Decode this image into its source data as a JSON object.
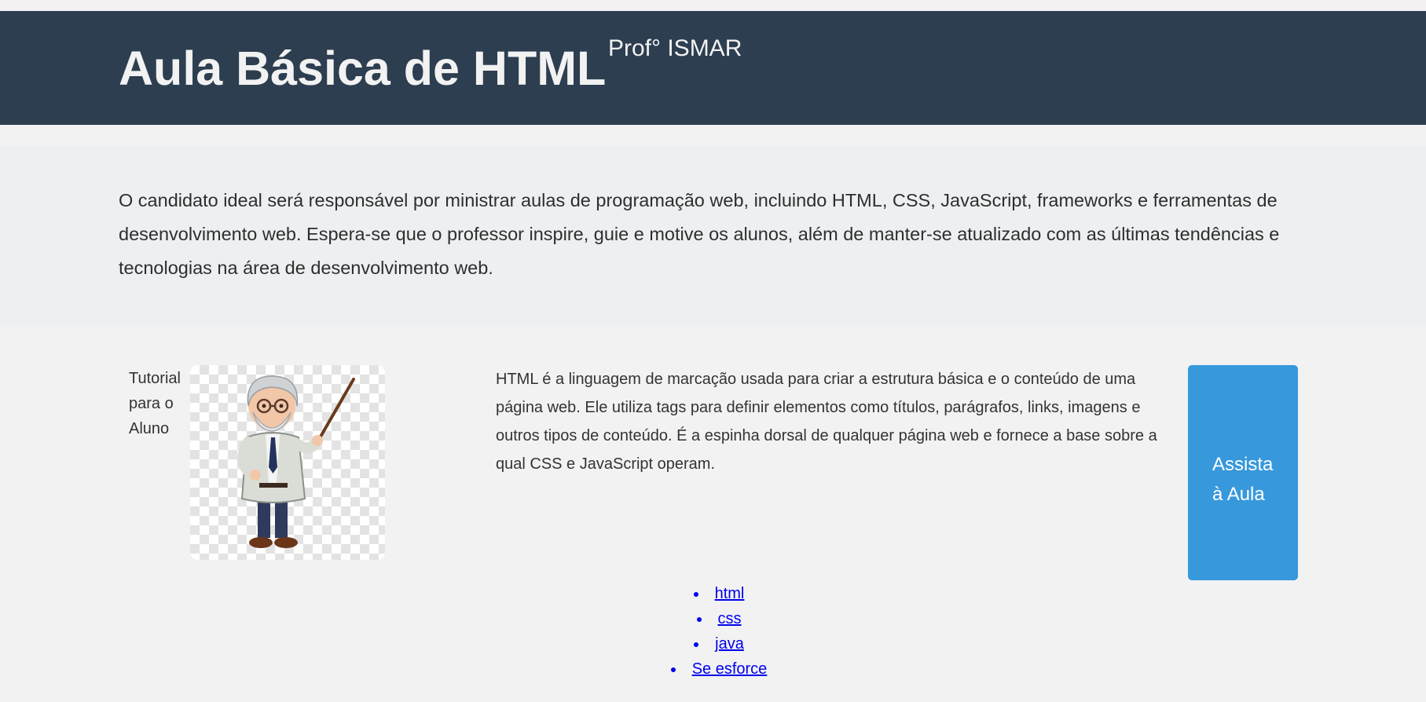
{
  "header": {
    "title": "Aula Básica de HTML",
    "subtitle": "Prof° ISMAR"
  },
  "intro": {
    "text": "O candidato ideal será responsável por ministrar aulas de programação web, incluindo HTML, CSS, JavaScript, frameworks e ferramentas de desenvolvimento web. Espera-se que o professor inspire, guie e motive os alunos, além de manter-se atualizado com as últimas tendências e tecnologias na área de desenvolvimento web."
  },
  "tutorial": {
    "label": "Tutorial para o Aluno",
    "image_icon": "teacher-cartoon-icon"
  },
  "content": {
    "description": "HTML é a linguagem de marcação usada para criar a estrutura básica e o conteúdo de uma página web. Ele utiliza tags para definir elementos como títulos, parágrafos, links, imagens e outros tipos de conteúdo. É a espinha dorsal de qualquer página web e fornece a base sobre a qual CSS e JavaScript operam."
  },
  "cta": {
    "label": "Assista à Aula"
  },
  "links": [
    {
      "label": "html"
    },
    {
      "label": "css"
    },
    {
      "label": "java"
    },
    {
      "label": "Se esforce"
    }
  ],
  "colors": {
    "header_bg": "#2d3e50",
    "intro_bg": "#ecf0f1",
    "button_bg": "#3798dc",
    "link": "#0000ee"
  }
}
